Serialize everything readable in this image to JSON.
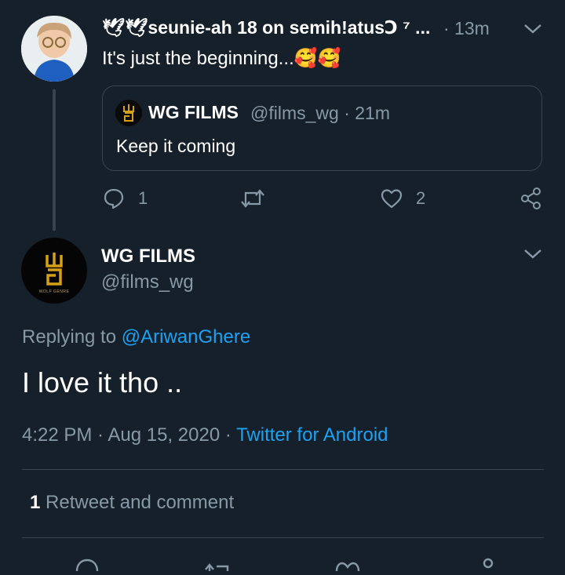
{
  "parent_tweet": {
    "display_name": "🕊🕊seunie-ah 18 on semih!atusↃ ⁷ ...",
    "time": "· 13m",
    "text": "It's just the beginning...🥰🥰",
    "quoted": {
      "display_name": "WG FILMS",
      "handle_time": "@films_wg · 21m",
      "text": "Keep it coming"
    },
    "actions": {
      "reply_count": "1",
      "retweet_count": "",
      "like_count": "2"
    }
  },
  "main_tweet": {
    "display_name": "WG FILMS",
    "handle": "@films_wg",
    "logo_caption": "WOLF GENRE",
    "replying_prefix": "Replying to",
    "replying_to": "@AriwanGhere",
    "text": "I love it tho ..",
    "timestamp": "4:22 PM · Aug 15, 2020 ·",
    "source": "Twitter for Android",
    "stats": {
      "count": "1",
      "label": "Retweet and comment"
    }
  },
  "colors": {
    "background": "#15202b",
    "border": "#38444d",
    "muted": "#8899a6",
    "link": "#1da1f2",
    "logo_gold": "#d4a017"
  }
}
